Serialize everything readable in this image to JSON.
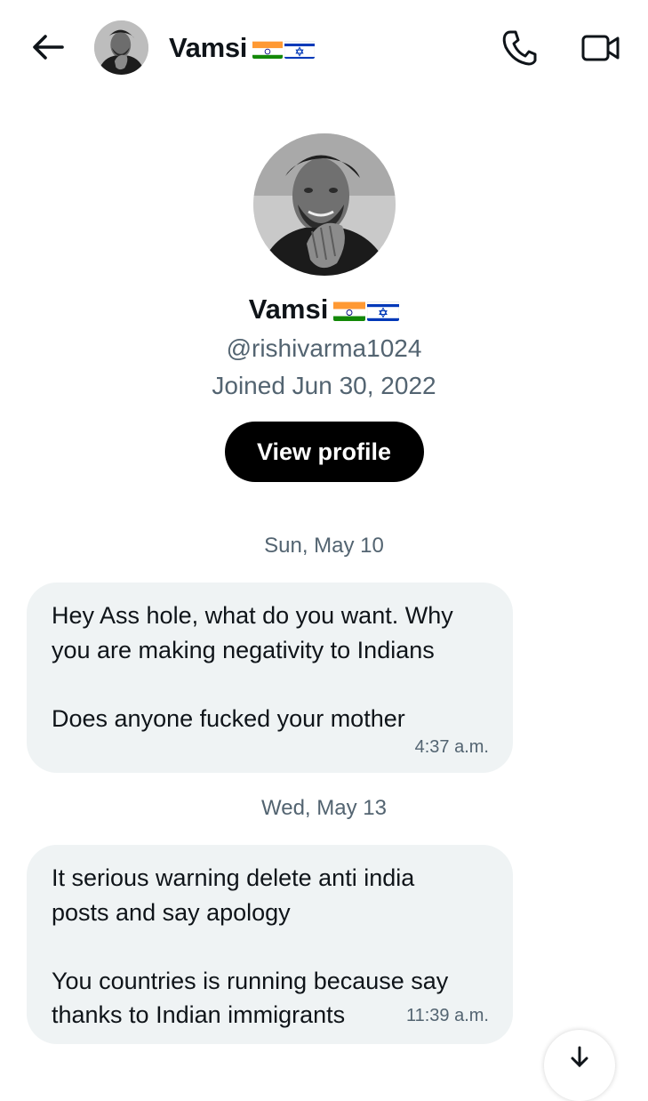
{
  "header": {
    "back_icon": "arrow-left-icon",
    "name": "Vamsi",
    "call_icon": "phone-icon",
    "video_icon": "video-camera-icon"
  },
  "profile": {
    "name": "Vamsi",
    "handle": "@rishivarma1024",
    "joined": "Joined Jun 30, 2022",
    "view_profile_label": "View profile",
    "flags": [
      "india-flag",
      "israel-flag"
    ]
  },
  "messages": [
    {
      "date": "Sun, May 10",
      "text": "Hey Ass hole, what do you want. Why\nyou are making negativity to Indians\n\nDoes anyone fucked your mother",
      "time": "4:37 a.m."
    },
    {
      "date": "Wed, May 13",
      "text": "It serious warning delete anti india\nposts and say apology\n\nYou countries is running because say\nthanks to Indian immigrants",
      "time": "11:39 a.m."
    }
  ],
  "scroll_down_icon": "arrow-down-icon",
  "colors": {
    "text_primary": "#0f1419",
    "text_secondary": "#536471",
    "bubble_bg": "#eff3f4",
    "button_bg": "#000000"
  }
}
